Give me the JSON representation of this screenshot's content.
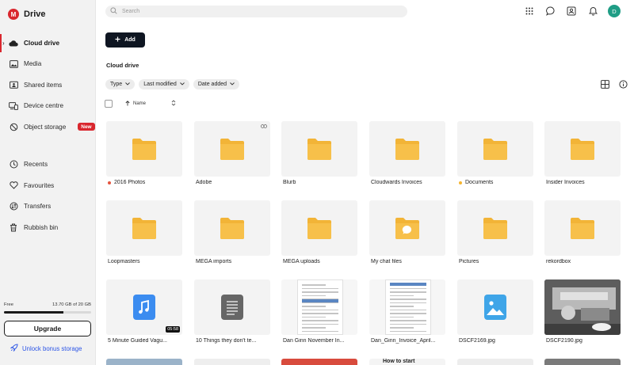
{
  "app": {
    "name": "Drive",
    "logo_letter": "M",
    "brand_color": "#d9272e"
  },
  "sidebar": {
    "items": [
      {
        "label": "Cloud drive",
        "icon": "cloud-icon",
        "active": true
      },
      {
        "label": "Media",
        "icon": "image-icon"
      },
      {
        "label": "Shared items",
        "icon": "shared-folder-icon"
      },
      {
        "label": "Device centre",
        "icon": "devices-icon"
      },
      {
        "label": "Object storage",
        "icon": "object-storage-icon",
        "badge": "New"
      },
      {
        "label": "Recents",
        "icon": "clock-icon"
      },
      {
        "label": "Favourites",
        "icon": "heart-icon"
      },
      {
        "label": "Transfers",
        "icon": "transfers-icon"
      },
      {
        "label": "Rubbish bin",
        "icon": "trash-icon"
      }
    ],
    "storage": {
      "plan": "Free",
      "usage_text": "13.70 GB of 20 GB",
      "used_fraction": 0.685
    },
    "upgrade_label": "Upgrade",
    "unlock_label": "Unlock bonus storage"
  },
  "topbar": {
    "search_placeholder": "Search",
    "icons": [
      "apps-grid-icon",
      "chat-icon",
      "contacts-icon",
      "bell-icon"
    ],
    "avatar_letter": "D"
  },
  "toolbar": {
    "add_label": "Add"
  },
  "breadcrumb": "Cloud drive",
  "filters": [
    "Type",
    "Last modified",
    "Date added"
  ],
  "sort": {
    "label": "Name",
    "direction_icon": "arrow-up-icon"
  },
  "items": [
    {
      "name": "2016 Photos",
      "kind": "folder",
      "label_color": "#e5533d"
    },
    {
      "name": "Adobe",
      "kind": "folder",
      "shared": true
    },
    {
      "name": "Blurb",
      "kind": "folder"
    },
    {
      "name": "Cloudwards Invoices",
      "kind": "folder"
    },
    {
      "name": "Documents",
      "kind": "folder",
      "label_color": "#f5b530"
    },
    {
      "name": "Insider Invoices",
      "kind": "folder"
    },
    {
      "name": "Loopmasters",
      "kind": "folder"
    },
    {
      "name": "MEGA imports",
      "kind": "folder"
    },
    {
      "name": "MEGA uploads",
      "kind": "folder"
    },
    {
      "name": "My chat files",
      "kind": "chat-folder"
    },
    {
      "name": "Pictures",
      "kind": "folder"
    },
    {
      "name": "rekordbox",
      "kind": "folder"
    },
    {
      "name": "5 Minute Guided Vagu...",
      "kind": "audio",
      "duration": "05:58"
    },
    {
      "name": "10 Things they don't te...",
      "kind": "text"
    },
    {
      "name": "Dan Ginn November In...",
      "kind": "document"
    },
    {
      "name": "Dan_Ginn_Invoice_April...",
      "kind": "document"
    },
    {
      "name": "DSCF2169.jpg",
      "kind": "image"
    },
    {
      "name": "DSCF2190.jpg",
      "kind": "photo"
    }
  ],
  "partial_row": {
    "visible_text": "How to start"
  }
}
